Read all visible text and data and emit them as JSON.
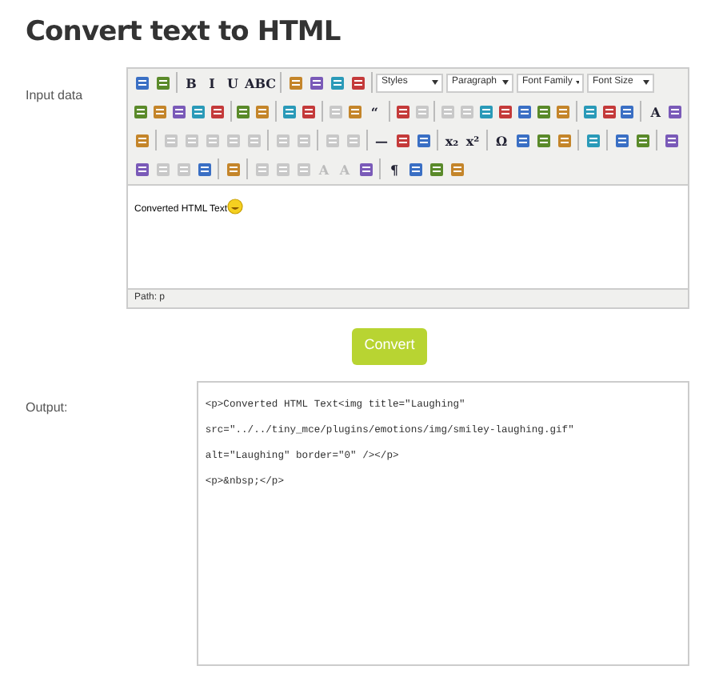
{
  "title": "Convert text to HTML",
  "input": {
    "label": "Input data",
    "toolbars": [
      [
        {
          "kind": "button",
          "disabled": false
        },
        {
          "kind": "button",
          "disabled": false
        },
        {
          "kind": "sep"
        },
        {
          "kind": "button",
          "glyph": "B",
          "disabled": false
        },
        {
          "kind": "button",
          "glyph": "I",
          "disabled": false
        },
        {
          "kind": "button",
          "glyph": "U",
          "disabled": false
        },
        {
          "kind": "button",
          "glyph": "ABC",
          "disabled": false
        },
        {
          "kind": "sep"
        },
        {
          "kind": "button",
          "disabled": false
        },
        {
          "kind": "button",
          "disabled": false
        },
        {
          "kind": "button",
          "disabled": false
        },
        {
          "kind": "button",
          "disabled": false
        },
        {
          "kind": "sep"
        },
        {
          "kind": "select",
          "label": "Styles"
        },
        {
          "kind": "select",
          "label": "Paragraph"
        },
        {
          "kind": "select",
          "label": "Font Family"
        },
        {
          "kind": "select",
          "label": "Font Size"
        }
      ],
      [
        {
          "kind": "button",
          "disabled": false
        },
        {
          "kind": "button",
          "disabled": false
        },
        {
          "kind": "button",
          "disabled": false
        },
        {
          "kind": "button",
          "disabled": false
        },
        {
          "kind": "button",
          "disabled": false
        },
        {
          "kind": "sep"
        },
        {
          "kind": "button",
          "disabled": false
        },
        {
          "kind": "button",
          "disabled": false
        },
        {
          "kind": "sep"
        },
        {
          "kind": "button",
          "disabled": false
        },
        {
          "kind": "button",
          "disabled": false
        },
        {
          "kind": "sep"
        },
        {
          "kind": "button",
          "disabled": true
        },
        {
          "kind": "button",
          "disabled": false
        },
        {
          "kind": "button",
          "glyph": "“",
          "disabled": false
        },
        {
          "kind": "sep"
        },
        {
          "kind": "button",
          "disabled": false
        },
        {
          "kind": "button",
          "disabled": true
        },
        {
          "kind": "sep"
        },
        {
          "kind": "button",
          "disabled": true
        },
        {
          "kind": "button",
          "disabled": true
        },
        {
          "kind": "button",
          "disabled": false
        },
        {
          "kind": "button",
          "disabled": false
        },
        {
          "kind": "button",
          "disabled": false
        },
        {
          "kind": "button",
          "disabled": false
        },
        {
          "kind": "button",
          "disabled": false
        },
        {
          "kind": "sep"
        },
        {
          "kind": "button",
          "disabled": false
        },
        {
          "kind": "button",
          "disabled": false
        },
        {
          "kind": "button",
          "disabled": false
        },
        {
          "kind": "sep"
        },
        {
          "kind": "button",
          "glyph": "A",
          "disabled": false
        },
        {
          "kind": "button",
          "disabled": false
        }
      ],
      [
        {
          "kind": "button",
          "disabled": false
        },
        {
          "kind": "sep"
        },
        {
          "kind": "button",
          "disabled": true
        },
        {
          "kind": "button",
          "disabled": true
        },
        {
          "kind": "button",
          "disabled": true
        },
        {
          "kind": "button",
          "disabled": true
        },
        {
          "kind": "button",
          "disabled": true
        },
        {
          "kind": "sep"
        },
        {
          "kind": "button",
          "disabled": true
        },
        {
          "kind": "button",
          "disabled": true
        },
        {
          "kind": "sep"
        },
        {
          "kind": "button",
          "disabled": true
        },
        {
          "kind": "button",
          "disabled": true
        },
        {
          "kind": "sep"
        },
        {
          "kind": "button",
          "glyph": "—",
          "disabled": false
        },
        {
          "kind": "button",
          "disabled": false
        },
        {
          "kind": "button",
          "disabled": false
        },
        {
          "kind": "sep"
        },
        {
          "kind": "button",
          "glyph": "x₂",
          "disabled": false
        },
        {
          "kind": "button",
          "glyph": "x²",
          "disabled": false
        },
        {
          "kind": "sep"
        },
        {
          "kind": "button",
          "glyph": "Ω",
          "disabled": false
        },
        {
          "kind": "button",
          "disabled": false
        },
        {
          "kind": "button",
          "disabled": false
        },
        {
          "kind": "button",
          "disabled": false
        },
        {
          "kind": "sep"
        },
        {
          "kind": "button",
          "disabled": false
        },
        {
          "kind": "sep"
        },
        {
          "kind": "button",
          "disabled": false
        },
        {
          "kind": "button",
          "disabled": false
        },
        {
          "kind": "sep"
        },
        {
          "kind": "button",
          "disabled": false
        }
      ],
      [
        {
          "kind": "button",
          "disabled": false
        },
        {
          "kind": "button",
          "disabled": true
        },
        {
          "kind": "button",
          "disabled": true
        },
        {
          "kind": "button",
          "disabled": false
        },
        {
          "kind": "sep"
        },
        {
          "kind": "button",
          "disabled": false
        },
        {
          "kind": "sep"
        },
        {
          "kind": "button",
          "disabled": true
        },
        {
          "kind": "button",
          "disabled": true
        },
        {
          "kind": "button",
          "disabled": true
        },
        {
          "kind": "button",
          "glyph": "A",
          "disabled": true
        },
        {
          "kind": "button",
          "glyph": "A",
          "disabled": true
        },
        {
          "kind": "button",
          "disabled": false
        },
        {
          "kind": "sep"
        },
        {
          "kind": "button",
          "glyph": "¶",
          "disabled": false
        },
        {
          "kind": "button",
          "disabled": false
        },
        {
          "kind": "button",
          "disabled": false
        },
        {
          "kind": "button",
          "disabled": false
        }
      ]
    ],
    "content": "Converted HTML Text",
    "path": "Path: p"
  },
  "convert_button": "Convert",
  "output": {
    "label": "Output:",
    "lines": [
      "<p>Converted HTML Text<img title=\"Laughing\"",
      "src=\"../../tiny_mce/plugins/emotions/img/smiley-laughing.gif\"",
      "alt=\"Laughing\" border=\"0\" /></p>",
      "<p>&nbsp;</p>"
    ]
  }
}
